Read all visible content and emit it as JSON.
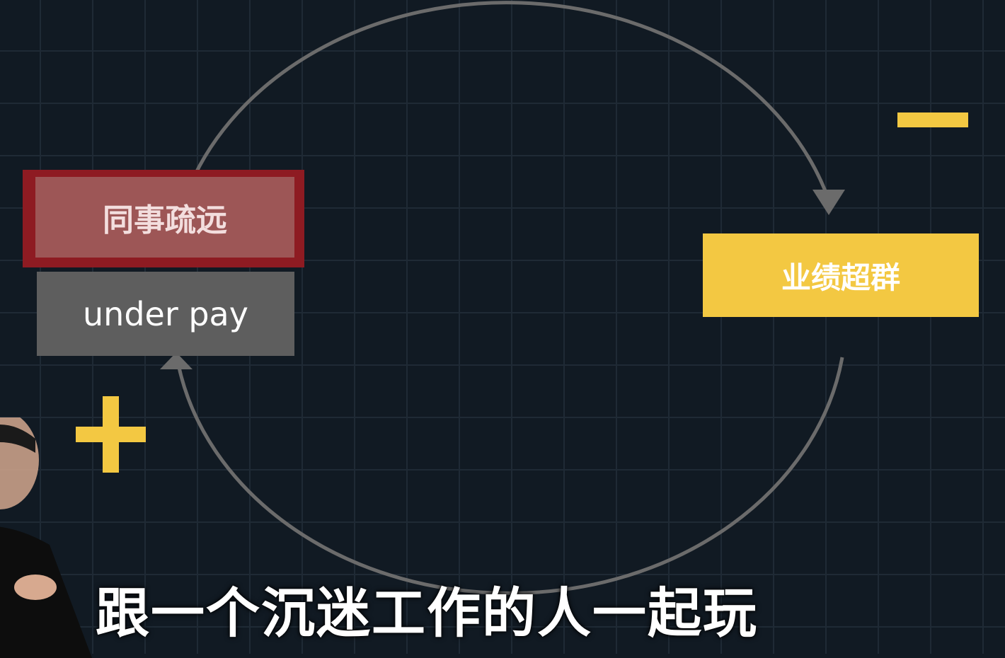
{
  "diagram": {
    "nodes": {
      "colleague_distance": "同事疏远",
      "under_pay": "under pay",
      "performance": "业绩超群"
    },
    "signs": {
      "negative": "minus",
      "positive": "plus"
    },
    "colors": {
      "background": "#111a23",
      "red": "#8e1b22",
      "gray": "#5e5e5e",
      "yellow": "#f3c842",
      "arrow": "#6b6b6b"
    }
  },
  "subtitle": "跟一个沉迷工作的人一起玩"
}
